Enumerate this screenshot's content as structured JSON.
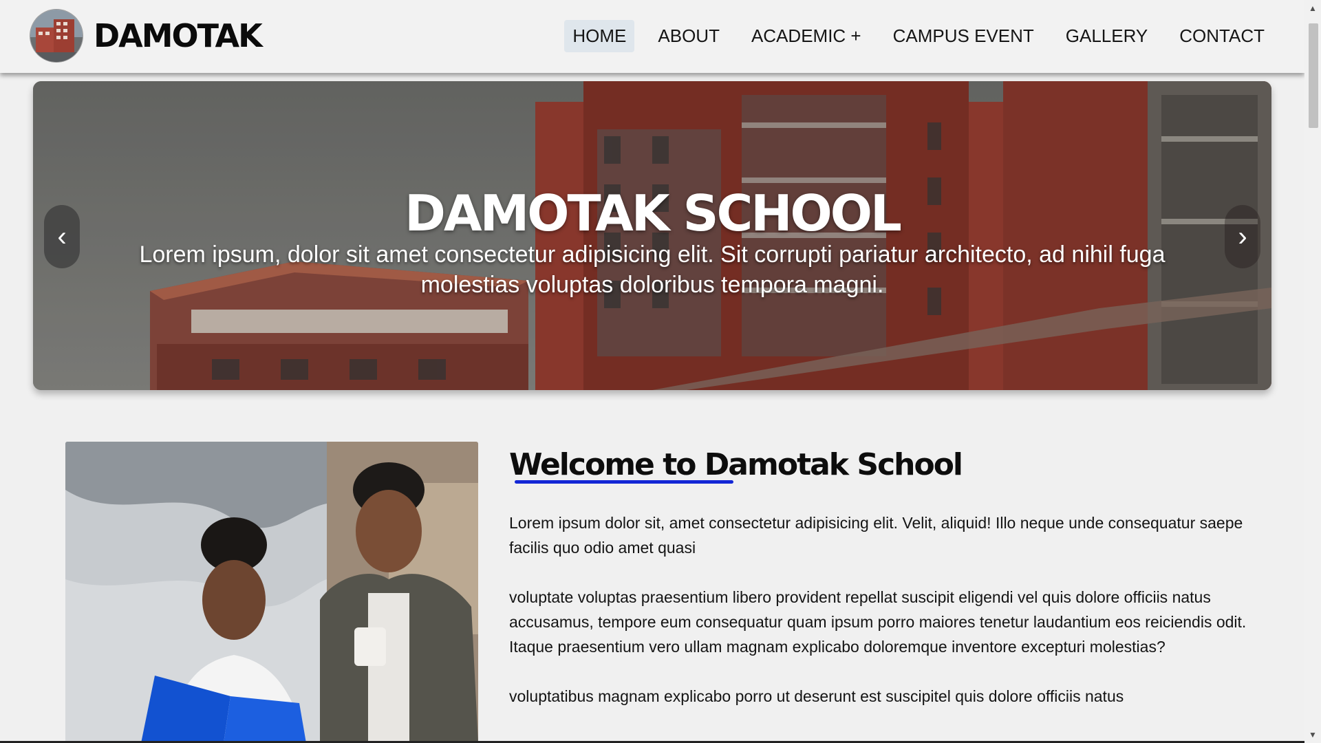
{
  "brand": {
    "name": "DAMOTAK",
    "logo_icon": "school-building-logo"
  },
  "nav": {
    "items": [
      {
        "label": "HOME",
        "active": true
      },
      {
        "label": "ABOUT",
        "active": false
      },
      {
        "label": "ACADEMIC +",
        "active": false
      },
      {
        "label": "CAMPUS EVENT",
        "active": false
      },
      {
        "label": "GALLERY",
        "active": false
      },
      {
        "label": "CONTACT",
        "active": false
      }
    ]
  },
  "hero": {
    "title": "DAMOTAK SCHOOL",
    "text": "Lorem ipsum, dolor sit amet consectetur adipisicing elit. Sit corrupti pariatur architecto, ad nihil fuga molestias voluptas doloribus tempora magni.",
    "prev_icon": "‹",
    "next_icon": "›"
  },
  "welcome": {
    "title": "Welcome to Damotak School",
    "paragraphs": [
      "Lorem ipsum dolor sit, amet consectetur adipisicing elit. Velit, aliquid! Illo neque unde consequatur saepe facilis quo odio amet quasi",
      "voluptate voluptas praesentium libero provident repellat suscipit eligendi vel quis dolore officiis natus accusamus, tempore eum consequatur quam ipsum porro maiores tenetur laudantium eos reiciendis odit. Itaque praesentium vero ullam magnam explicabo doloremque inventore excepturi molestias?",
      "voluptatibus magnam explicabo porro ut deserunt est suscipitel quis dolore officiis natus"
    ]
  },
  "colors": {
    "accent_underline": "#1327d6",
    "nav_active_bg": "#dfe6ec",
    "page_bg": "#f0f0f0"
  }
}
